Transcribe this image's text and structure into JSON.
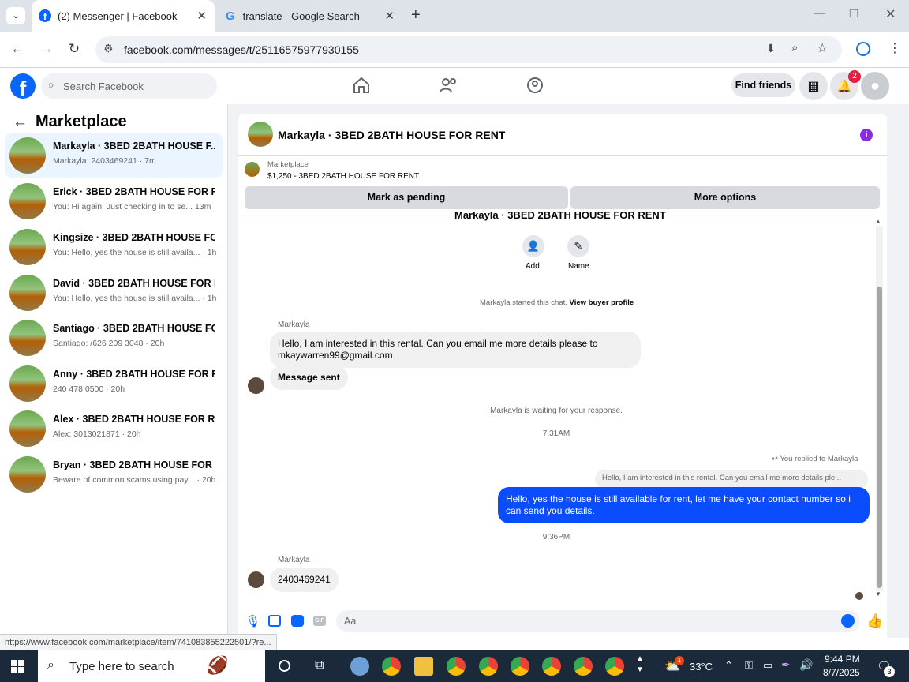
{
  "browser": {
    "tabs": [
      {
        "title": "(2) Messenger | Facebook",
        "active": true
      },
      {
        "title": "translate - Google Search",
        "active": false
      }
    ],
    "url": "facebook.com/messages/t/25116575977930155",
    "status_url": "https://www.facebook.com/marketplace/item/741083855222501/?re..."
  },
  "fb": {
    "search_placeholder": "Search Facebook",
    "find_friends": "Find friends",
    "notification_count": "2"
  },
  "sidebar": {
    "title": "Marketplace",
    "conversations": [
      {
        "name": "Markayla · 3BED 2BATH HOUSE F...",
        "preview": "Markayla: 2403469241 · 7m",
        "selected": true
      },
      {
        "name": "Erick · 3BED 2BATH HOUSE FOR R...",
        "preview": "You: Hi again! Just checking in to se...  13m"
      },
      {
        "name": "Kingsize · 3BED 2BATH HOUSE FO...",
        "preview": "You: Hello, yes the house is still availa... · 1h"
      },
      {
        "name": "David · 3BED 2BATH HOUSE FOR R...",
        "preview": "You: Hello, yes the house is still availa... · 1h"
      },
      {
        "name": "Santiago · 3BED 2BATH HOUSE FO...",
        "preview": "Santiago: /626 209 3048 · 20h"
      },
      {
        "name": "Anny · 3BED 2BATH HOUSE FOR R...",
        "preview": "240 478 0500 · 20h"
      },
      {
        "name": "Alex · 3BED 2BATH HOUSE FOR RE...",
        "preview": "Alex: 3013021871 · 20h"
      },
      {
        "name": "Bryan · 3BED 2BATH HOUSE FOR R...",
        "preview": "Beware of common scams using pay... · 20h"
      }
    ]
  },
  "chat": {
    "title": "Markayla · 3BED 2BATH HOUSE FOR RENT",
    "listing_label": "Marketplace",
    "listing_detail": "$1,250 - 3BED 2BATH HOUSE FOR RENT",
    "mark_pending": "Mark as pending",
    "more_options": "More options",
    "scrolled_title": "Markayla · 3BED 2BATH HOUSE FOR RENT",
    "add_label": "Add",
    "name_label": "Name",
    "started_text": "Markayla started this chat.",
    "view_buyer": "View buyer profile",
    "sender1": "Markayla",
    "msg1": "Hello, I am interested in this rental. Can you email me more details please to mkaywarren99@gmail.com",
    "msg2": "Message sent",
    "waiting": "Markayla is waiting for your response.",
    "time1": "7:31AM",
    "replied_to": "You replied to Markayla",
    "quoted": "Hello, I am interested in this rental. Can you email me more details ple...",
    "my_msg": "Hello, yes the house is still available for rent, let me have your contact number so i can send you details.",
    "time2": "9:36PM",
    "sender2": "Markayla",
    "msg3": "2403469241",
    "composer_placeholder": "Aa"
  },
  "taskbar": {
    "search_placeholder": "Type here to search",
    "weather": "33°C",
    "weather_badge": "1",
    "time": "9:44 PM",
    "date": "8/7/2025",
    "notif_count": "3"
  },
  "colors": {
    "fb_blue": "#0866ff",
    "my_bubble": "#0a4cff",
    "selected_row": "#ebf5ff",
    "info_purple": "#8a2be2"
  }
}
